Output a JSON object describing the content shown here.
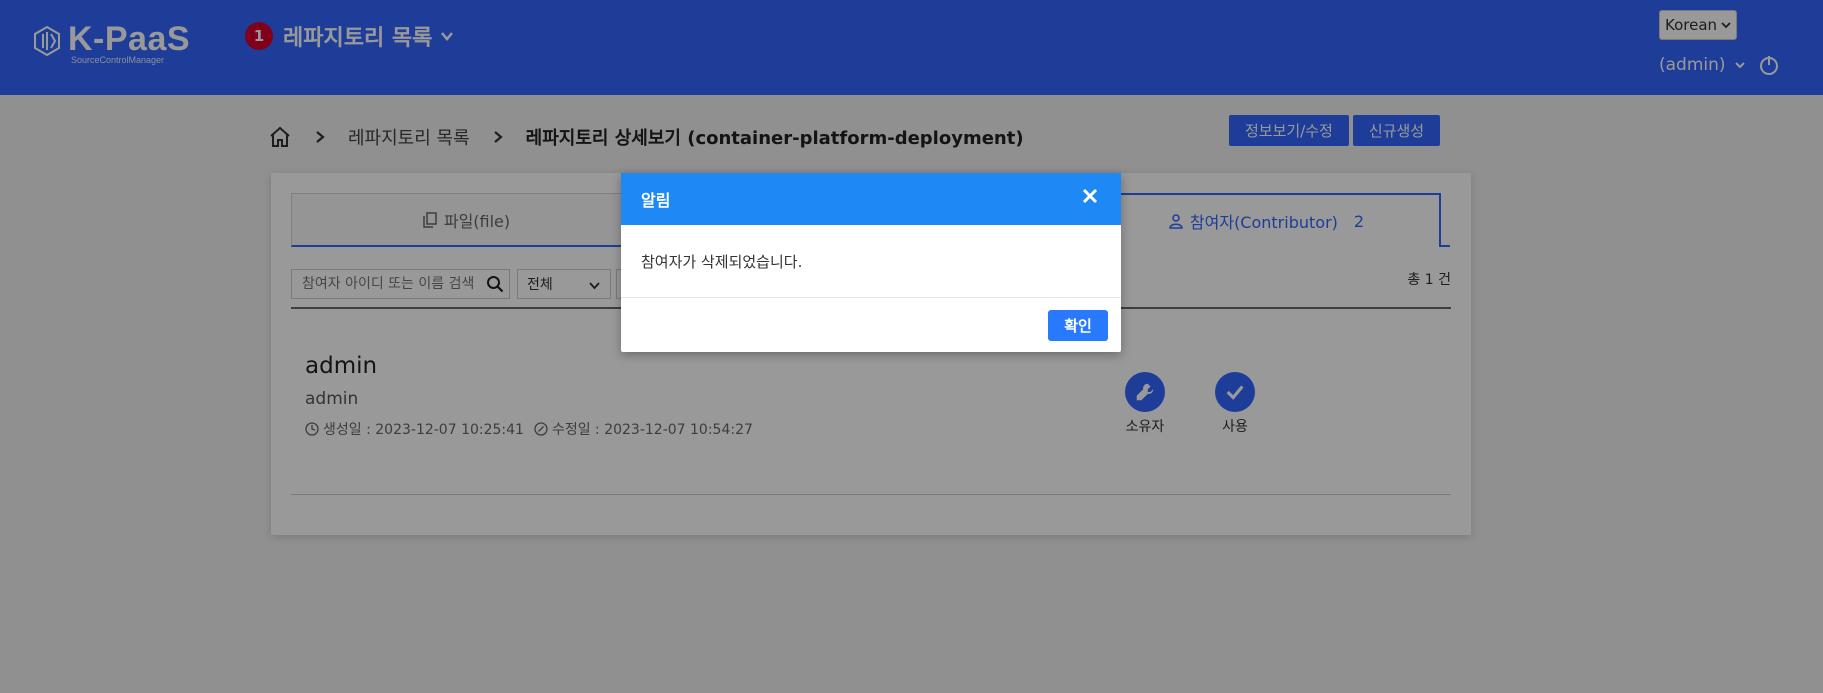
{
  "header": {
    "logo_text": "K-PaaS",
    "logo_subtitle": "SourceControlManager",
    "nav_badge": "1",
    "nav_title": "레파지토리 목록",
    "language": "Korean",
    "user": "(admin)",
    "colors": {
      "header_bg": "#3366ff",
      "badge": "#d6002f"
    }
  },
  "breadcrumb": {
    "items": [
      "레파지토리 목록",
      "레파지토리 상세보기 (container-platform-deployment)"
    ]
  },
  "top_buttons": {
    "edit": "정보보기/수정",
    "create": "신규생성"
  },
  "tabs": {
    "file": "파일(file)",
    "contributor": "참여자(Contributor)",
    "contributor_count": "2"
  },
  "filter": {
    "search_placeholder": "참여자 아이디 또는 이름 검색",
    "select_value": "전체",
    "total": "총 1 건"
  },
  "contributor": {
    "name": "admin",
    "id": "admin",
    "created": "생성일 : 2023-12-07 10:25:41",
    "modified": "수정일 : 2023-12-07 10:54:27",
    "roles": [
      "소유자",
      "사용"
    ]
  },
  "modal": {
    "title": "알림",
    "message": "참여자가 삭제되었습니다.",
    "ok": "확인"
  }
}
